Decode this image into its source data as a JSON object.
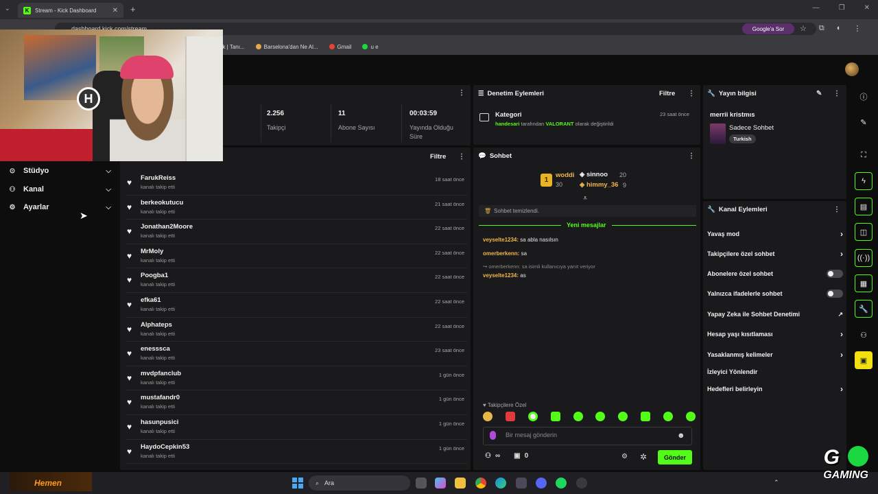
{
  "browser": {
    "tab_title": "Stream - Kick Dashboard",
    "url": "dashboard.kick.com/stream",
    "google_button": "Google'a Sor",
    "bookmarks": [
      "ük | Tanı...",
      "Barselona'dan Ne Al...",
      "Gmail",
      "u e"
    ]
  },
  "sidebar": {
    "items": [
      {
        "label": "Stüdyo",
        "icon": "studio-icon"
      },
      {
        "label": "Kanal",
        "icon": "channel-icon"
      },
      {
        "label": "Ayarlar",
        "icon": "gear-icon"
      }
    ]
  },
  "stats": [
    {
      "value": "2.256",
      "label": "Takipçi"
    },
    {
      "value": "11",
      "label": "Abone Sayısı"
    },
    {
      "value": "00:03:59",
      "label": "Yayında Olduğu Süre"
    }
  ],
  "followers": {
    "filter_label": "Filtre",
    "subtitle": "kanalı takip etti",
    "rows": [
      {
        "name": "FarukReiss",
        "time": "18 saat önce"
      },
      {
        "name": "berkeokutucu",
        "time": "21 saat önce"
      },
      {
        "name": "Jonathan2Moore",
        "time": "22 saat önce"
      },
      {
        "name": "MrMoly",
        "time": "22 saat önce"
      },
      {
        "name": "Poogba1",
        "time": "22 saat önce"
      },
      {
        "name": "efka61",
        "time": "22 saat önce"
      },
      {
        "name": "Alphateps",
        "time": "22 saat önce"
      },
      {
        "name": "enesssca",
        "time": "23 saat önce"
      },
      {
        "name": "mvdpfanclub",
        "time": "1 gün önce"
      },
      {
        "name": "mustafandr0",
        "time": "1 gün önce"
      },
      {
        "name": "hasunpusici",
        "time": "1 gün önce"
      },
      {
        "name": "HaydoCepkin53",
        "time": "1 gün önce"
      }
    ]
  },
  "moderation": {
    "title": "Denetim Eylemleri",
    "filter_label": "Filtre",
    "event_title": "Kategori",
    "event_user": "handesari",
    "event_mid": "tarafından",
    "event_game": "VALORANT",
    "event_end": "olarak değiştirildi",
    "event_time": "23 saat önce"
  },
  "chat": {
    "title": "Sohbet",
    "leaderboard": {
      "rank": "1",
      "first_name": "woddi",
      "first_count": "30",
      "second_name": "sinnoo",
      "second_count": "20",
      "third_name": "himmy_36",
      "third_count": "9"
    },
    "cleared": "Sohbet temizlendi.",
    "new_messages": "Yeni mesajlar",
    "messages": [
      {
        "user": "veyselte1234:",
        "text": "sa abla nasılsın"
      },
      {
        "user": "omerberkenn:",
        "text": "sa"
      },
      {
        "user": "veyselte1234:",
        "text": "as"
      }
    ],
    "reply_hint": "omerberkenn: sa isimli kullanıcıya yanıt veriyor",
    "follow_only": "Takipçilere Özel",
    "input_placeholder": "Bir mesaj gönderin",
    "loop_symbol": "∞",
    "gift_count": "0",
    "send_label": "Gönder"
  },
  "stream_info": {
    "title": "Yayın bilgisi",
    "stream_title": "merrii kristmıs",
    "category": "Sadece Sohbet",
    "language": "Turkish"
  },
  "channel_actions": {
    "title": "Kanal Eylemleri",
    "items": [
      {
        "label": "Yavaş mod",
        "type": "chevron"
      },
      {
        "label": "Takipçilere özel sohbet",
        "type": "chevron"
      },
      {
        "label": "Abonelere özel sohbet",
        "type": "toggle"
      },
      {
        "label": "Yalnızca ifadelerle sohbet",
        "type": "toggle"
      },
      {
        "label": "Yapay Zeka ile Sohbet Denetimi",
        "type": "external"
      },
      {
        "label": "Hesap yaşı kısıtlaması",
        "type": "chevron"
      },
      {
        "label": "Yasaklanmış kelimeler",
        "type": "chevron"
      },
      {
        "label": "İzleyici Yönlendir",
        "type": "none"
      },
      {
        "label": "Hedefleri belirleyin",
        "type": "chevron"
      }
    ]
  },
  "taskbar": {
    "search_label": "Ara",
    "ad_label": "Hemen"
  },
  "overlay": {
    "brand": "GAMING",
    "brand_mark": "G"
  },
  "colors": {
    "accent": "#53fc18",
    "background": "#0d0d0e",
    "panel": "#1a1a1c",
    "username": "#f0b84a"
  }
}
